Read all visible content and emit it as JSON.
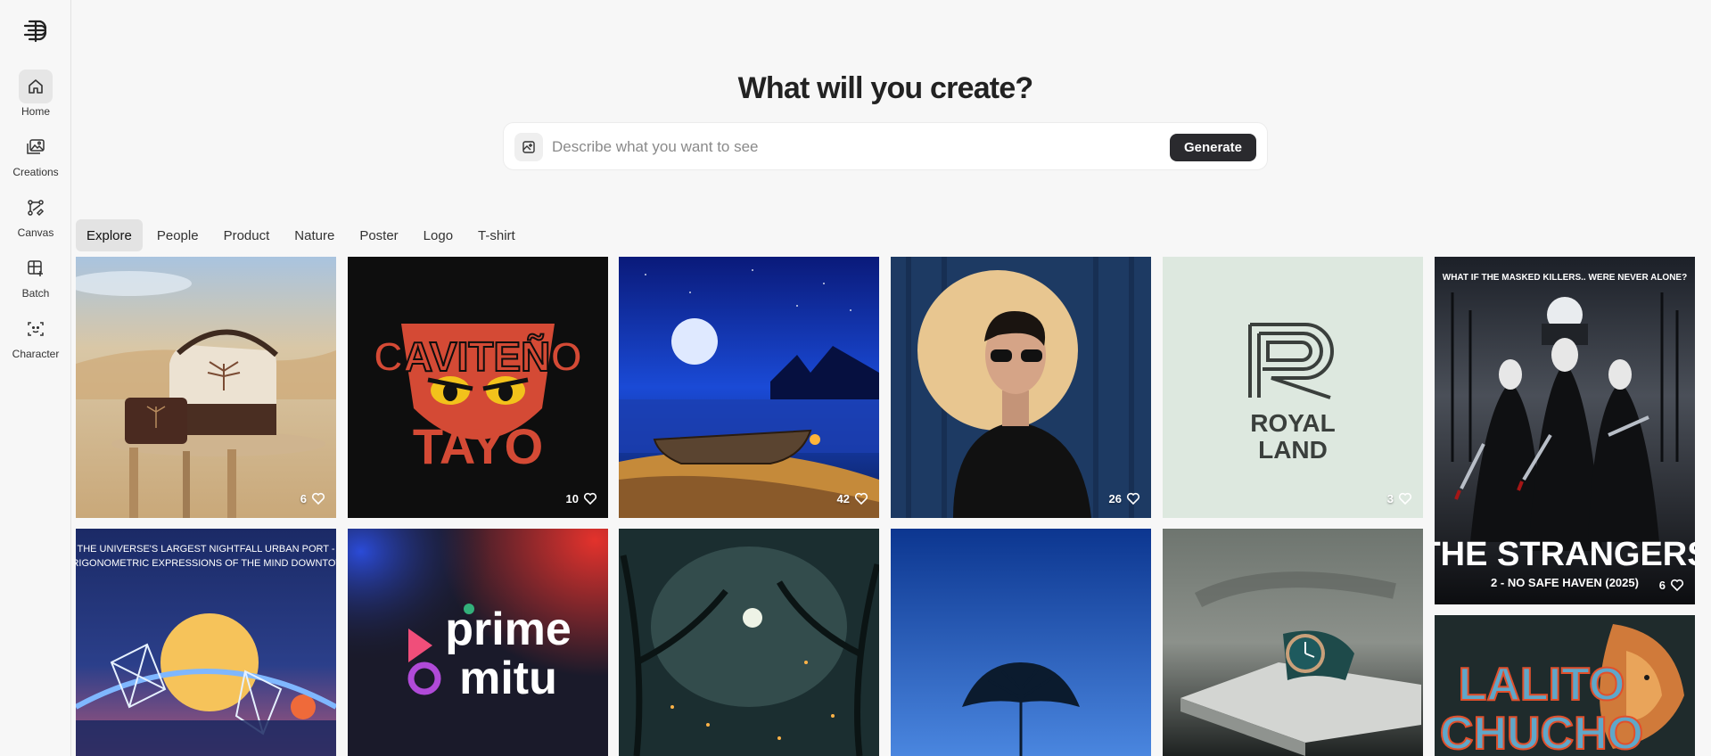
{
  "sidebar": {
    "items": [
      {
        "label": "Home",
        "icon": "home-icon",
        "active": true
      },
      {
        "label": "Creations",
        "icon": "images-icon"
      },
      {
        "label": "Canvas",
        "icon": "canvas-icon"
      },
      {
        "label": "Batch",
        "icon": "batch-icon"
      },
      {
        "label": "Character",
        "icon": "character-icon"
      }
    ]
  },
  "header": {
    "title": "What will you create?",
    "prompt_placeholder": "Describe what you want to see",
    "generate_label": "Generate"
  },
  "tabs": [
    "Explore",
    "People",
    "Product",
    "Nature",
    "Poster",
    "Logo",
    "T-shirt"
  ],
  "gallery": [
    {
      "subject": "omani-handbag",
      "likes": "6"
    },
    {
      "subject": "cavitenyo-tayo-logo",
      "likes": "10",
      "text_line1": "CAVITEÑO",
      "text_line2": "TAYO"
    },
    {
      "subject": "moonlit-boat",
      "likes": "42"
    },
    {
      "subject": "portrait-sunglasses",
      "likes": "26"
    },
    {
      "subject": "royal-land-logo",
      "likes": "3",
      "text_line1": "ROYAL",
      "text_line2": "LAND"
    },
    {
      "subject": "strangers-poster",
      "likes": "6",
      "tagline": "WHAT IF THE MASKED KILLERS.. WERE NEVER ALONE?",
      "title": "THE STRANGERS",
      "subtitle": "2 - NO SAFE HAVEN (2025)"
    },
    {
      "subject": "urban-port-poster",
      "headline1": "THE UNIVERSE'S LARGEST NIGHTFALL URBAN PORT -",
      "headline2": "- TRIGONOMETRIC EXPRESSIONS OF THE MIND DOWNTOWN"
    },
    {
      "subject": "prime-mitu-logo",
      "text_line1": "prime",
      "text_line2": "mitu"
    },
    {
      "subject": "moonlit-forest"
    },
    {
      "subject": "lone-tree-night"
    },
    {
      "subject": "wristwatch"
    },
    {
      "subject": "lalito-chucho-poster",
      "text_line1": "LALITO",
      "text_line2": "CHUCHO"
    }
  ],
  "colors": {
    "accent": "#2a2a2e",
    "tab_active": "#e3e3e3",
    "background": "#f7f7f7"
  }
}
